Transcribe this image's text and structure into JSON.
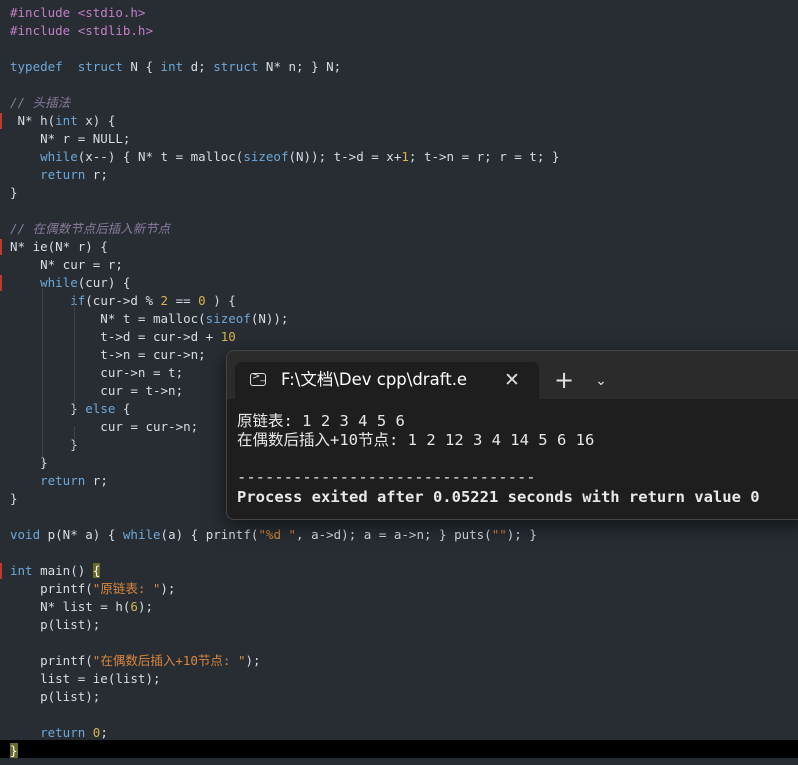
{
  "editor": {
    "lines": [
      [
        [
          "pp",
          "#include <stdio.h>"
        ]
      ],
      [
        [
          "pp",
          "#include <stdlib.h>"
        ]
      ],
      [],
      [
        [
          "kw",
          "typedef"
        ],
        [
          "",
          "  "
        ],
        [
          "kw",
          "struct"
        ],
        [
          "",
          " N { "
        ],
        [
          "kw",
          "int"
        ],
        [
          "",
          " d; "
        ],
        [
          "kw",
          "struct"
        ],
        [
          "",
          " N* n; } N;"
        ]
      ],
      [],
      [
        [
          "cm",
          "// 头插法"
        ]
      ],
      [
        [
          "",
          " N* h("
        ],
        [
          "kw",
          "int"
        ],
        [
          "",
          " x) {"
        ]
      ],
      [
        [
          "",
          "    N* r = NULL;"
        ]
      ],
      [
        [
          "kw",
          "    while"
        ],
        [
          "",
          "(x--) { N* t = malloc("
        ],
        [
          "kw",
          "sizeof"
        ],
        [
          "",
          "(N)); t->d = x+"
        ],
        [
          "nm",
          "1"
        ],
        [
          "",
          "; t->n = r; r = t; }"
        ]
      ],
      [
        [
          "kw",
          "    return"
        ],
        [
          "",
          " r;"
        ]
      ],
      [
        [
          "",
          "}"
        ]
      ],
      [],
      [
        [
          "cm",
          "// 在偶数节点后插入新节点"
        ]
      ],
      [
        [
          "",
          "N* ie(N* r) {"
        ]
      ],
      [
        [
          "",
          "    N* cur = r;"
        ]
      ],
      [
        [
          "kw",
          "    while"
        ],
        [
          "",
          "(cur) {"
        ]
      ],
      [
        [
          "kw",
          "        if"
        ],
        [
          "",
          "(cur->d % "
        ],
        [
          "nm",
          "2"
        ],
        [
          "",
          " == "
        ],
        [
          "nm",
          "0"
        ],
        [
          "",
          " ) {"
        ]
      ],
      [
        [
          "",
          "            N* t = malloc("
        ],
        [
          "kw",
          "sizeof"
        ],
        [
          "",
          "(N));"
        ]
      ],
      [
        [
          "",
          "            t->d = cur->d + "
        ],
        [
          "nm",
          "10"
        ],
        [
          ";"
        ]
      ],
      [
        [
          "",
          "            t->n = cur->n;"
        ]
      ],
      [
        [
          "",
          "            cur->n = t;"
        ]
      ],
      [
        [
          "",
          "            cur = t->n;"
        ]
      ],
      [
        [
          "",
          "        } "
        ],
        [
          "kw",
          "else"
        ],
        [
          "",
          " {"
        ]
      ],
      [
        [
          "",
          "            cur = cur->n;"
        ]
      ],
      [
        [
          "",
          "        }"
        ]
      ],
      [
        [
          "",
          "    }"
        ]
      ],
      [
        [
          "kw",
          "    return"
        ],
        [
          "",
          " r;"
        ]
      ],
      [
        [
          "",
          "}"
        ]
      ],
      [],
      [
        [
          "kw",
          "void"
        ],
        [
          "",
          " p(N* a) { "
        ],
        [
          "kw",
          "while"
        ],
        [
          "",
          "(a) { printf("
        ],
        [
          "st",
          "\"%d \""
        ],
        [
          "",
          ", a->d); a = a->n; } puts("
        ],
        [
          "st",
          "\"\""
        ],
        [
          "",
          "); }"
        ]
      ],
      [],
      [
        [
          "kw",
          "int"
        ],
        [
          "",
          " main() "
        ],
        [
          "hl",
          "{"
        ]
      ],
      [
        [
          "",
          "    printf("
        ],
        [
          "st",
          "\"原链表: \""
        ],
        [
          "",
          ");"
        ]
      ],
      [
        [
          "",
          "    N* list = h("
        ],
        [
          "nm",
          "6"
        ],
        [
          "",
          ");"
        ]
      ],
      [
        [
          "",
          "    p(list);"
        ]
      ],
      [],
      [
        [
          "",
          "    printf("
        ],
        [
          "st",
          "\"在偶数后插入+10节点: \""
        ],
        [
          "",
          ");"
        ]
      ],
      [
        [
          "",
          "    list = ie(list);"
        ]
      ],
      [
        [
          "",
          "    p(list);"
        ]
      ],
      [],
      [
        [
          "kw",
          "    return"
        ],
        [
          "",
          " "
        ],
        [
          "nm",
          "0"
        ],
        [
          "",
          ";"
        ]
      ],
      [
        [
          "hl",
          "}"
        ]
      ]
    ]
  },
  "console": {
    "tab_title": "F:\\文档\\Dev cpp\\draft.e",
    "close_glyph": "✕",
    "new_tab_glyph": "+",
    "dropdown_glyph": "⌄",
    "prompt_glyph": ">_",
    "output": [
      "原链表: 1 2 3 4 5 6",
      "在偶数后插入+10节点: 1 2 12 3 4 14 5 6 16",
      "",
      "--------------------------------",
      "Process exited after 0.05221 seconds with return value 0"
    ]
  },
  "colors": {
    "editor_bg": "#272d33",
    "keyword": "#6fa7d8",
    "preprocessor": "#c27fc7",
    "comment": "#8a7a9c",
    "string": "#d9873f",
    "number": "#d9b44a",
    "console_bg": "#1e1e1e",
    "console_titlebar": "#2b2b2b"
  }
}
